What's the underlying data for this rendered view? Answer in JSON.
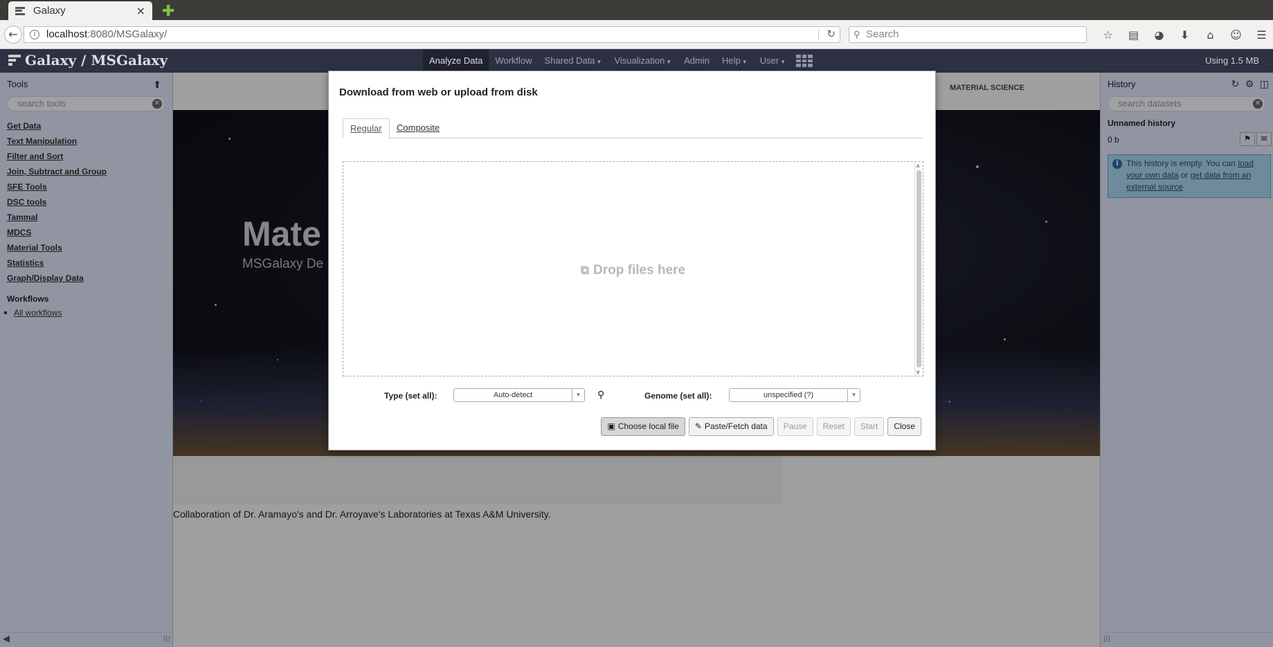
{
  "browser": {
    "tab_title": "Galaxy",
    "tab_close": "×",
    "new_tab": "✚",
    "url_host": "localhost",
    "url_rest": ":8080/MSGalaxy/",
    "search_placeholder": "Search",
    "icons": [
      "bookmark-star-icon",
      "reading-list-icon",
      "pocket-icon",
      "download-icon",
      "home-icon",
      "chat-icon",
      "menu-icon"
    ]
  },
  "masthead": {
    "brand": "Galaxy / MSGalaxy",
    "menu": [
      {
        "label": "Analyze Data",
        "caret": false
      },
      {
        "label": "Workflow",
        "caret": false
      },
      {
        "label": "Shared Data",
        "caret": true
      },
      {
        "label": "Visualization",
        "caret": true
      },
      {
        "label": "Admin",
        "caret": false
      },
      {
        "label": "Help",
        "caret": true
      },
      {
        "label": "User",
        "caret": true
      }
    ],
    "usage": "Using 1.5 MB"
  },
  "tools_panel": {
    "title": "Tools",
    "search_placeholder": "search tools",
    "sections": [
      "Get Data",
      "Text Manipulation",
      "Filter and Sort",
      "Join, Subtract and Group",
      "SFE Tools",
      "DSC tools",
      "Tammal",
      "MDCS",
      "Material Tools",
      "Statistics",
      "Graph/Display Data"
    ],
    "workflows_title": "Workflows",
    "all_workflows": "All workflows"
  },
  "center": {
    "header_tag": "MATERIAL SCIENCE",
    "hero_title": "Mate",
    "hero_subtitle": "MSGalaxy De",
    "collab_text": "Collaboration of Dr. Aramayo's and Dr. Arroyave's Laboratories at Texas A&M University."
  },
  "history_panel": {
    "title": "History",
    "search_placeholder": "search datasets",
    "name": "Unnamed history",
    "size": "0 b",
    "empty_msg_1": "This history is empty. You can ",
    "link_load": "load your own data",
    "empty_msg_2": " or ",
    "link_get": "get data from an external source"
  },
  "upload_dialog": {
    "title": "Download from web or upload from disk",
    "tab_regular": "Regular",
    "tab_composite": "Composite",
    "drop_text": "Drop files here",
    "type_label": "Type (set all):",
    "type_value": "Auto-detect",
    "genome_label": "Genome (set all):",
    "genome_value": "unspecified (?)",
    "buttons": {
      "choose_local": "Choose local file",
      "paste_fetch": "Paste/Fetch data",
      "pause": "Pause",
      "reset": "Reset",
      "start": "Start",
      "close": "Close"
    }
  }
}
